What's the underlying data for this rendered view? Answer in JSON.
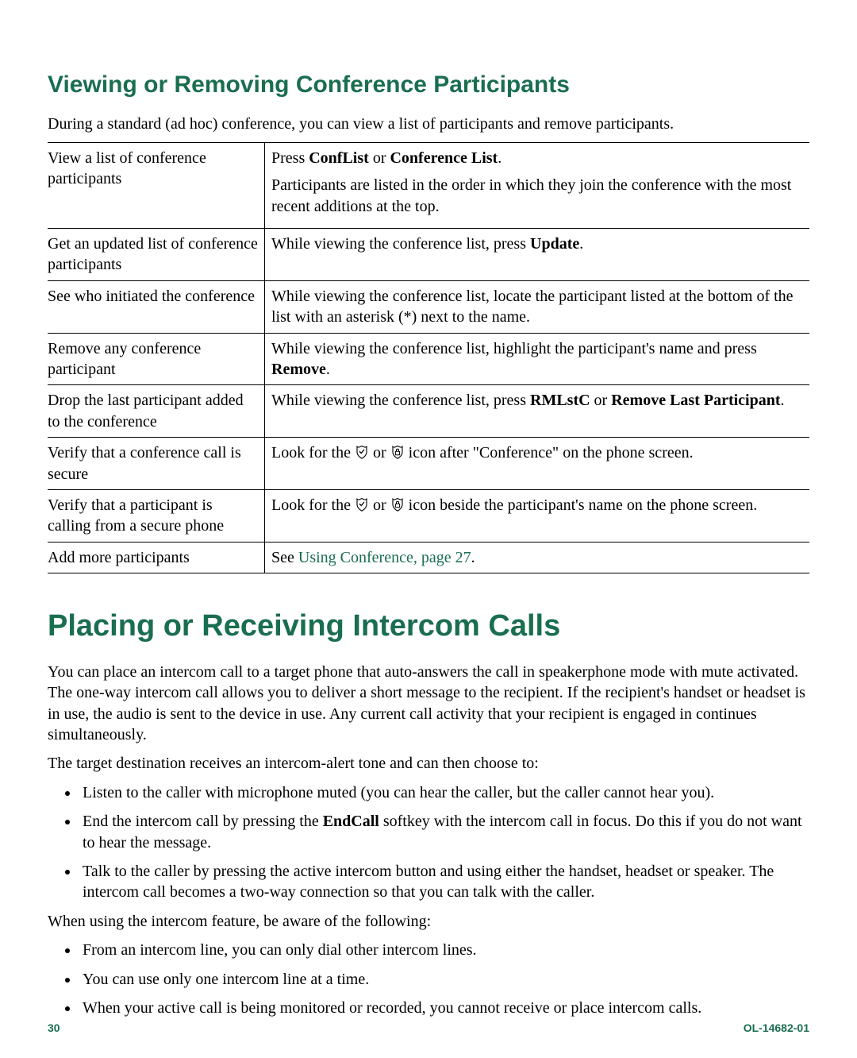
{
  "section1": {
    "heading": "Viewing or Removing Conference Participants",
    "intro": "During a standard (ad hoc) conference, you can view a list of participants and remove participants.",
    "rows": [
      {
        "left": "View a list of conference participants",
        "r_press": "Press ",
        "r_b1": "ConfList",
        "r_or": " or ",
        "r_b2": "Conference List",
        "r_dot": ".",
        "r_p2": "Participants are listed in the order in which they join the conference with the most recent additions at the top."
      },
      {
        "left": "Get an updated list of conference participants",
        "r_pre": "While viewing the conference list, press ",
        "r_b1": "Update",
        "r_dot": "."
      },
      {
        "left": "See who initiated the conference",
        "r_full": "While viewing the conference list, locate the participant listed at the bottom of the list with an asterisk (*) next to the name."
      },
      {
        "left": "Remove any conference participant",
        "r_pre": "While viewing the conference list, highlight the participant's name and press ",
        "r_b1": "Remove",
        "r_dot": "."
      },
      {
        "left": "Drop the last participant added to the conference",
        "r_pre": "While viewing the conference list, press ",
        "r_b1": "RMLstC",
        "r_or": " or ",
        "r_b2": "Remove Last Participant",
        "r_dot": "."
      },
      {
        "left": "Verify that a conference call is secure",
        "r_pre": "Look for the ",
        "r_mid": " or ",
        "r_post": " icon after \"Conference\" on the phone screen."
      },
      {
        "left": "Verify that a participant is calling from a secure phone",
        "r_pre": "Look for the ",
        "r_mid": " or ",
        "r_post": " icon beside the participant's name on the phone screen."
      },
      {
        "left": "Add more participants",
        "r_pre": "See ",
        "r_link": "Using Conference, page 27",
        "r_dot": "."
      }
    ]
  },
  "section2": {
    "heading": "Placing or Receiving Intercom Calls",
    "p1": "You can place an intercom call to a target phone that auto-answers the call in speakerphone mode with mute activated. The one-way intercom call allows you to deliver a short message to the recipient. If the recipient's handset or headset is in use, the audio is sent to the device in use. Any current call activity that your recipient is engaged in continues simultaneously.",
    "p2": "The target destination receives an intercom-alert tone and can then choose to:",
    "bullets1": {
      "b0": "Listen to the caller with microphone muted (you can hear the caller, but the caller cannot hear you).",
      "b1_a": "End the intercom call by pressing the ",
      "b1_b": "EndCall",
      "b1_c": " softkey with the intercom call in focus. Do this if you do not want to hear the message.",
      "b2": "Talk to the caller by pressing the active intercom button and using either the handset, headset or speaker. The intercom call becomes a two-way connection so that you can talk with the caller."
    },
    "p3": "When using the intercom feature, be aware of the following:",
    "bullets2": {
      "b0": "From an intercom line, you can only dial other intercom lines.",
      "b1": "You can use only one intercom line at a time.",
      "b2": "When your active call is being monitored or recorded, you cannot receive or place intercom calls."
    }
  },
  "footer": {
    "page": "30",
    "docid": "OL-14682-01"
  }
}
